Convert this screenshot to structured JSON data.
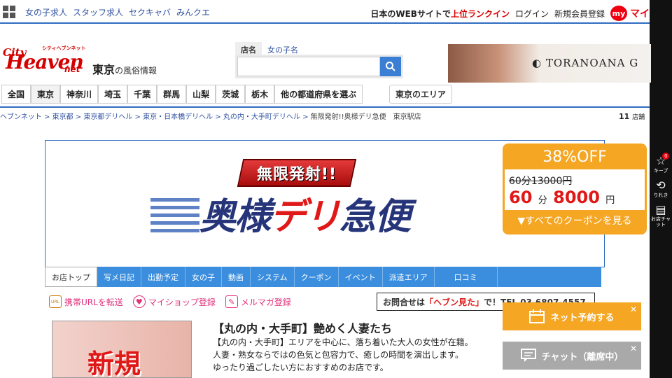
{
  "topbar": {
    "links": [
      "女の子求人",
      "スタッフ求人",
      "セクキャバ",
      "みんクエ"
    ],
    "ranking_prefix": "日本のWEBサイトで",
    "ranking_highlight": "上位ランクイン",
    "login": "ログイン",
    "register": "新規会員登録",
    "my_badge": "my",
    "my_text": "マイ"
  },
  "header": {
    "logo_city": "City",
    "logo_heaven": "Heaven",
    "logo_sub": "シティヘブンネット",
    "logo_net": "net",
    "region": "東京",
    "region_suffix": "の風俗情報"
  },
  "search": {
    "tab_shop": "店名",
    "tab_girl": "女の子名",
    "placeholder": ""
  },
  "ad": {
    "brand": "TORANOANA G"
  },
  "prefectures": [
    "全国",
    "東京",
    "神奈川",
    "埼玉",
    "千葉",
    "群馬",
    "山梨",
    "茨城",
    "栃木",
    "他の都道府県を選ぶ"
  ],
  "area_button": "東京のエリア",
  "breadcrumb": {
    "items": [
      "ヘブンネット",
      "東京都",
      "東京都デリヘル",
      "東京・日本橋デリヘル",
      "丸の内・大手町デリヘル"
    ],
    "current": "無限発射!!奥様デリ急便　東京駅店",
    "sep": ">"
  },
  "count": {
    "value": "11",
    "unit": "店舗"
  },
  "shop_banner": {
    "tagline": "無限発射!!",
    "name_a": "奥様",
    "name_b": "デリ",
    "name_c": "急便"
  },
  "coupon": {
    "discount": "38%OFF",
    "old_price": "60分13000円",
    "new_minutes": "60",
    "new_unit_min": "分",
    "new_price": "8000",
    "new_yen": "円",
    "all_link": "▼すべてのクーポンを見る"
  },
  "shop_nav": [
    "お店トップ",
    "写メ日記",
    "出勤予定",
    "女の子",
    "動画",
    "システム",
    "クーポン",
    "イベント",
    "派遣エリア",
    "口コミ"
  ],
  "utils": [
    {
      "label": "携帯URLを転送",
      "icon": "url-icon",
      "color": "#2e4fa0",
      "glyph": "URL"
    },
    {
      "label": "マイショップ登録",
      "icon": "heart-icon",
      "color": "#e0307a",
      "glyph": "♥"
    },
    {
      "label": "メルマガ登録",
      "icon": "pencil-icon",
      "color": "#2e4fa0",
      "glyph": "✎"
    }
  ],
  "inquiry": {
    "prefix": "お問合せは",
    "highlight": "「ヘブン見た」",
    "suffix": "で！TEL 03-6807-4557"
  },
  "thumb_text": "新規",
  "description": {
    "title": "【丸の内・大手町】艶めく人妻たち",
    "lines": [
      "【丸の内・大手町】エリアを中心に、落ち着いた大人の女性が在籍。",
      "人妻・熟女ならではの色気と包容力で、癒しの時間を演出します。",
      "ゆったり過ごしたい方におすすめのお店です。"
    ]
  },
  "floating": {
    "reserve": "ネット予約する",
    "chat": "チャット（離席中）"
  },
  "side_tools": [
    {
      "label": "キープ",
      "icon": "star-icon",
      "glyph": "☆",
      "badge": "0"
    },
    {
      "label": "りれき",
      "icon": "history-icon",
      "glyph": "⟲"
    },
    {
      "label": "お店チャット",
      "icon": "chat-icon",
      "glyph": "▤"
    }
  ],
  "colors": {
    "brand_red": "#d40000",
    "nav_blue": "#3b8ede",
    "coupon_orange": "#f5a623",
    "link_blue": "#2e4fa0"
  }
}
